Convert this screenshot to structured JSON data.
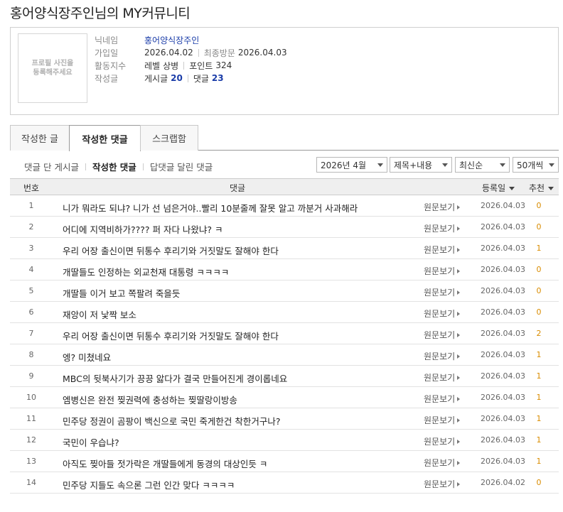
{
  "page_title": "홍어양식장주인님의 MY커뮤니티",
  "profile": {
    "photo_text": "프로필 사진을\n등록해주세요",
    "labels": {
      "nickname": "닉네임",
      "joined": "가입일",
      "activity": "활동지수",
      "posts": "작성글"
    },
    "nickname": "홍어양식장주인",
    "join_date": "2026.04.02",
    "last_visit_label": "최종방문",
    "last_visit": "2026.04.03",
    "level_label": "레벨",
    "level": "상병",
    "points_label": "포인트",
    "points": "324",
    "posts_label": "게시글",
    "posts_count": "20",
    "comments_label": "댓글",
    "comments_count": "23"
  },
  "tabs": [
    "작성한 글",
    "작성한 댓글",
    "스크랩함"
  ],
  "active_tab": 1,
  "subnav": [
    "댓글 단 게시글",
    "작성한 댓글",
    "답댓글 달린 댓글"
  ],
  "filters": {
    "month": "2026년 4월",
    "scope": "제목+내용",
    "sort": "최신순",
    "per_page": "50개씩"
  },
  "columns": {
    "num": "번호",
    "comment": "댓글",
    "date": "등록일",
    "rec": "추천"
  },
  "view_label": "원문보기",
  "rows": [
    {
      "num": "1",
      "text": "니가 뭐라도 되냐? 니가 선 넘은거야..빨리 10분줄께 잘못 알고 까분거 사과해라",
      "date": "2026.04.03",
      "rec": "0"
    },
    {
      "num": "2",
      "text": "어디에 지역비하가???? 퍼 자다 나왔냐? ㅋ",
      "date": "2026.04.03",
      "rec": "0"
    },
    {
      "num": "3",
      "text": "우리 어장 출신이면 뒤통수 후리기와 거짓말도 잘해야 한다",
      "date": "2026.04.03",
      "rec": "1"
    },
    {
      "num": "4",
      "text": "개딸들도 인정하는 외교천재 대통령 ㅋㅋㅋㅋ",
      "date": "2026.04.03",
      "rec": "0"
    },
    {
      "num": "5",
      "text": "개딸들 이거 보고 쪽팔려 죽을듯",
      "date": "2026.04.03",
      "rec": "0"
    },
    {
      "num": "6",
      "text": "재앙이 저 낯짝 보소",
      "date": "2026.04.03",
      "rec": "0"
    },
    {
      "num": "7",
      "text": "우리 어장 출신이면 뒤통수 후리기와 거짓말도 잘해야 한다",
      "date": "2026.04.03",
      "rec": "2"
    },
    {
      "num": "8",
      "text": "엥? 미쳤네요",
      "date": "2026.04.03",
      "rec": "1"
    },
    {
      "num": "9",
      "text": "MBC의 뒷북사기가 끙끙 앓다가 결국 만들어진게 경이롭네요",
      "date": "2026.04.03",
      "rec": "1"
    },
    {
      "num": "10",
      "text": "엠병신은 완전 찢권력에 충성하는 찢딸랑이방송",
      "date": "2026.04.03",
      "rec": "1"
    },
    {
      "num": "11",
      "text": "민주당 정권이 곰팡이 백신으로 국민 죽게한건 착한거구나?",
      "date": "2026.04.03",
      "rec": "1"
    },
    {
      "num": "12",
      "text": "국민이 우습냐?",
      "date": "2026.04.03",
      "rec": "1"
    },
    {
      "num": "13",
      "text": "아직도 찢아들 젓가락은 개딸들에게 동경의 대상인듯 ㅋ",
      "date": "2026.04.03",
      "rec": "1"
    },
    {
      "num": "14",
      "text": "민주당 지들도 속으론 그런 인간 맞다 ㅋㅋㅋㅋ",
      "date": "2026.04.02",
      "rec": "0"
    }
  ]
}
